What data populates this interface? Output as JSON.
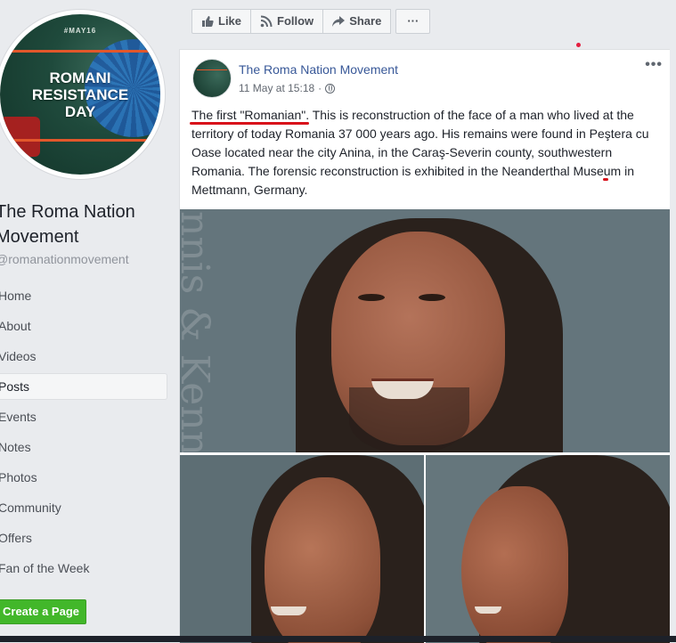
{
  "profile": {
    "cover_hashtag": "#MAY16",
    "cover_title_lines": [
      "ROMANI",
      "RESISTANCE",
      "DAY"
    ],
    "page_name": "The Roma Nation Movement",
    "handle": "@romanationmovement"
  },
  "nav": {
    "items": [
      {
        "label": "Home"
      },
      {
        "label": "About"
      },
      {
        "label": "Videos"
      },
      {
        "label": "Posts",
        "active": true
      },
      {
        "label": "Events"
      },
      {
        "label": "Notes"
      },
      {
        "label": "Photos"
      },
      {
        "label": "Community"
      },
      {
        "label": "Offers"
      },
      {
        "label": "Fan of the Week"
      }
    ],
    "create_page_label": "Create a Page"
  },
  "actions": {
    "like_label": "Like",
    "follow_label": "Follow",
    "share_label": "Share",
    "more_label": "···",
    "icons": {
      "like": "thumbs-up-icon",
      "follow": "rss-icon",
      "share": "share-arrow-icon"
    }
  },
  "post": {
    "author": "The Roma Nation Movement",
    "timestamp": "11 May at 15:18",
    "privacy_icon": "globe-icon",
    "menu_label": "•••",
    "text": {
      "part1": "The first \"Romanian\"",
      "part2": ". This is reconstruction of the face of a man who lived at the territory of today Romania 37 000 years ago. His remains were found in Peştera cu Oase located near the city Anina, in the Caraş-Severin county, southwester",
      "part3": "n Romania",
      "part4": ". The forensic reconstruction is exhibited in the Neanderthal Museum in Mettmann, Germany."
    },
    "photo_watermark": "nnis & Kenn"
  },
  "colors": {
    "link": "#385898",
    "create_button": "#42b72a",
    "underline_mark": "#d8101a",
    "background": "#e9ebee"
  }
}
